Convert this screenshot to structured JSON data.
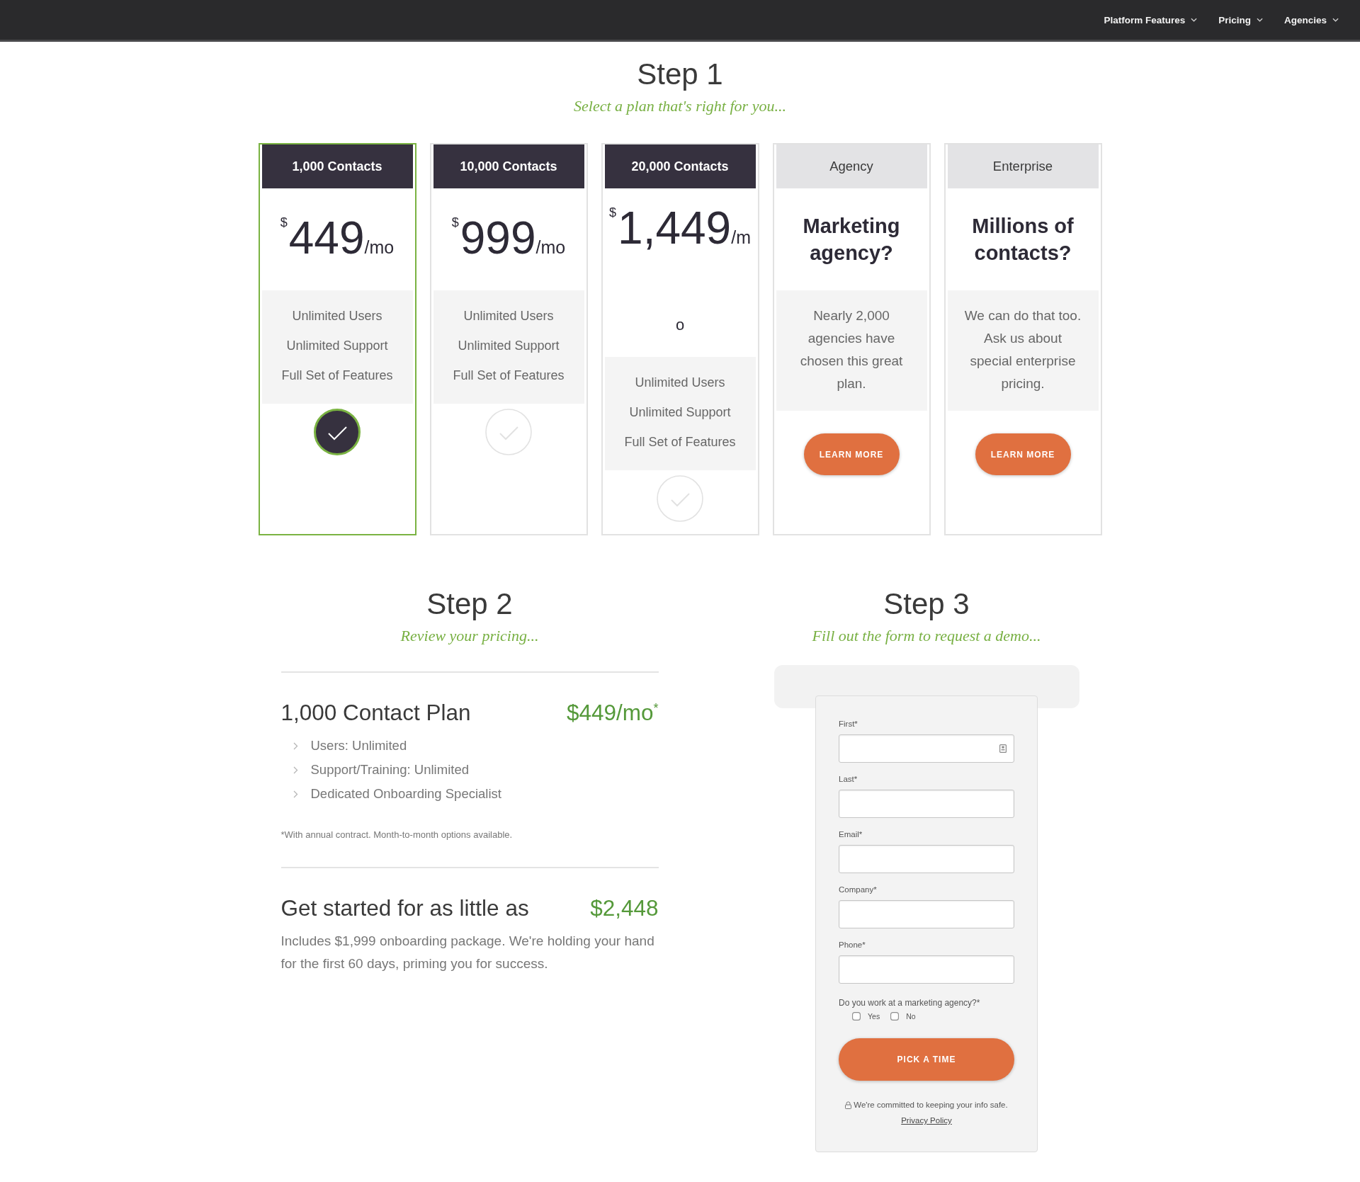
{
  "nav": {
    "items": [
      {
        "label": "Platform Features"
      },
      {
        "label": "Pricing"
      },
      {
        "label": "Agencies"
      }
    ]
  },
  "step1": {
    "title": "Step 1",
    "subtitle": "Select a plan that's right for you...",
    "plans": [
      {
        "kind": "price",
        "header": "1,000 Contacts",
        "currency": "$",
        "amount": "449",
        "period": "/mo",
        "features": [
          "Unlimited Users",
          "Unlimited Support",
          "Full Set of Features"
        ],
        "selected": true
      },
      {
        "kind": "price",
        "header": "10,000 Contacts",
        "currency": "$",
        "amount": "999",
        "period": "/mo",
        "features": [
          "Unlimited Users",
          "Unlimited Support",
          "Full Set of Features"
        ],
        "selected": false
      },
      {
        "kind": "price",
        "header": "20,000 Contacts",
        "currency": "$",
        "amount": "1,449",
        "period": "/m",
        "wrapped_text": "o",
        "features": [
          "Unlimited Users",
          "Unlimited Support",
          "Full Set of Features"
        ],
        "selected": false
      },
      {
        "kind": "pitch",
        "header": "Agency",
        "headline": "Marketing agency?",
        "description": "Nearly 2,000 agencies have chosen this great plan.",
        "button": "LEARN MORE"
      },
      {
        "kind": "pitch",
        "header": "Enterprise",
        "headline": "Millions of contacts?",
        "description": "We can do that too. Ask us about special enterprise pricing.",
        "button": "LEARN MORE"
      }
    ]
  },
  "step2": {
    "title": "Step 2",
    "subtitle": "Review your pricing...",
    "plan_name": "1,000 Contact Plan",
    "plan_price": "$449/mo$^{*}$",
    "details": [
      "Users: Unlimited",
      "Support/Training: Unlimited",
      "Dedicated Onboarding Specialist"
    ],
    "footnote": "*With annual contract. Month-to-month options available.",
    "total_label": "Get started for as little as",
    "total_price": "$2,448",
    "total_note": "Includes $1,999 onboarding package. We're holding your hand for the first 60 days, priming you for success."
  },
  "step3": {
    "title": "Step 3",
    "subtitle": "Fill out the form to request a demo...",
    "form": {
      "fields": [
        {
          "label": "First*",
          "autofill": true
        },
        {
          "label": "Last*"
        },
        {
          "label": "Email*"
        },
        {
          "label": "Company*"
        },
        {
          "label": "Phone*"
        }
      ],
      "question": "Do you work at a marketing agency?*",
      "options": [
        {
          "label": "Yes",
          "selected": false
        },
        {
          "label": "No",
          "selected": false
        }
      ],
      "submit": "PICK A TIME",
      "privacy_note": "We're committed to keeping your info safe.",
      "privacy_link": "Privacy Policy"
    }
  }
}
